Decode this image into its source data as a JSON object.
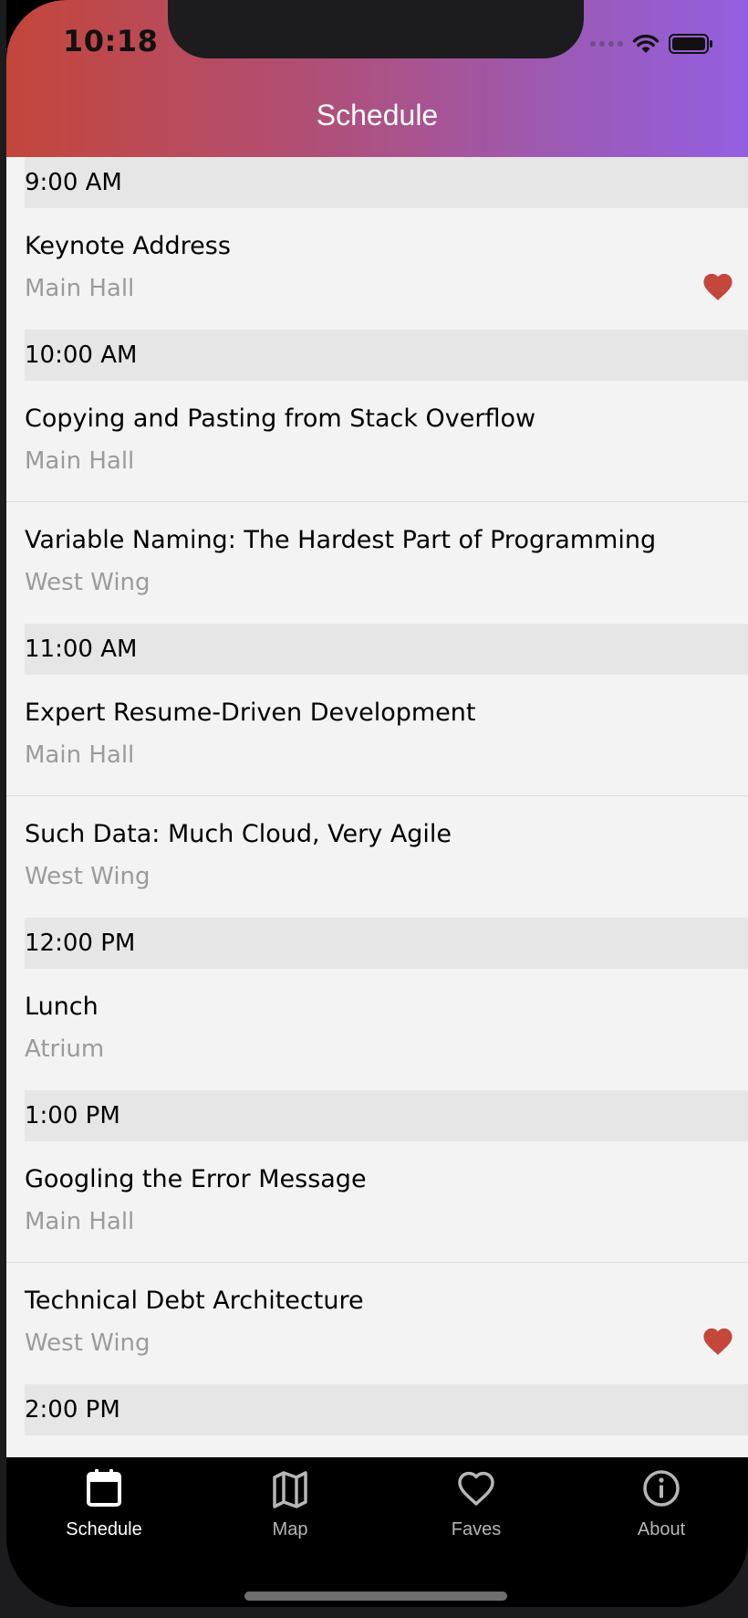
{
  "status_bar": {
    "time": "10:18"
  },
  "header": {
    "title": "Schedule"
  },
  "schedule": {
    "sections": [
      {
        "time": "9:00 AM"
      },
      {
        "time": "10:00 AM"
      },
      {
        "time": "11:00 AM"
      },
      {
        "time": "12:00 PM"
      },
      {
        "time": "1:00 PM"
      },
      {
        "time": "2:00 PM"
      }
    ],
    "sessions": [
      {
        "title": "Keynote Address",
        "location": "Main Hall",
        "favorited": true
      },
      {
        "title": "Copying and Pasting from Stack Overflow",
        "location": "Main Hall",
        "favorited": false
      },
      {
        "title": "Variable Naming: The Hardest Part of Programming",
        "location": "West Wing",
        "favorited": false
      },
      {
        "title": "Expert Resume-Driven Development",
        "location": "Main Hall",
        "favorited": false
      },
      {
        "title": "Such Data: Much Cloud, Very Agile",
        "location": "West Wing",
        "favorited": false
      },
      {
        "title": "Lunch",
        "location": "Atrium",
        "favorited": false
      },
      {
        "title": "Googling the Error Message",
        "location": "Main Hall",
        "favorited": false
      },
      {
        "title": "Technical Debt Architecture",
        "location": "West Wing",
        "favorited": true
      }
    ]
  },
  "tabs": [
    {
      "label": "Schedule",
      "icon": "calendar-icon",
      "active": true
    },
    {
      "label": "Map",
      "icon": "map-icon",
      "active": false
    },
    {
      "label": "Faves",
      "icon": "heart-outline-icon",
      "active": false
    },
    {
      "label": "About",
      "icon": "info-icon",
      "active": false
    }
  ],
  "colors": {
    "header_gradient_start": "#c3463a",
    "header_gradient_end": "#935fe1",
    "favorite": "#c5463a",
    "section_bg": "#e6e6e6",
    "row_bg": "#f3f3f3",
    "location_text": "#9b9b9b"
  }
}
